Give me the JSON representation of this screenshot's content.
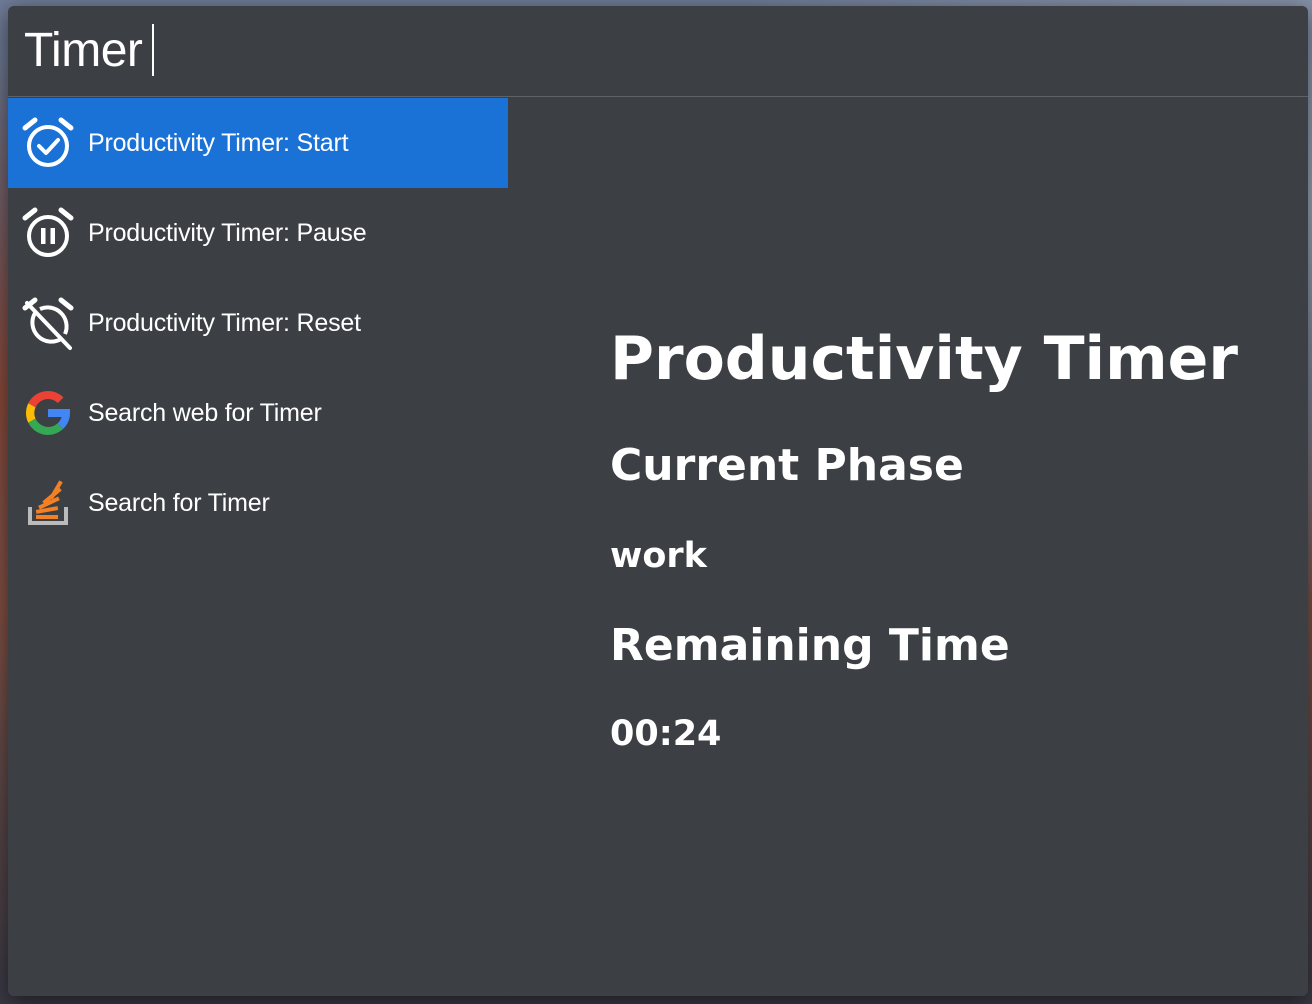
{
  "search": {
    "query": "Timer"
  },
  "results": [
    {
      "label": "Productivity Timer: Start",
      "icon": "alarm-check-icon",
      "selected": true
    },
    {
      "label": "Productivity Timer: Pause",
      "icon": "alarm-pause-icon",
      "selected": false
    },
    {
      "label": "Productivity Timer: Reset",
      "icon": "alarm-off-icon",
      "selected": false
    },
    {
      "label": "Search web for Timer",
      "icon": "google-icon",
      "selected": false
    },
    {
      "label": "Search for Timer",
      "icon": "stackoverflow-icon",
      "selected": false
    }
  ],
  "preview": {
    "title": "Productivity Timer",
    "phase_heading": "Current Phase",
    "phase_value": "work",
    "time_heading": "Remaining Time",
    "time_value": "00:24"
  },
  "colors": {
    "window_bg": "#3c3f44",
    "selection": "#1a72d6",
    "text": "#ffffff",
    "stackoverflow_orange": "#f48024",
    "stackoverflow_gray": "#bcbbbb"
  }
}
